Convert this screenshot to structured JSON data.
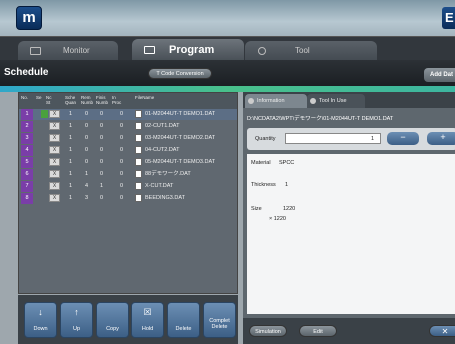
{
  "nav": {
    "monitor": "Monitor",
    "program": "Program",
    "tool": "Tool"
  },
  "header": {
    "title": "Schedule",
    "tcode": "T Code Conversion",
    "add": "Add Dat"
  },
  "columns": [
    "No.",
    "Se",
    "Nc\nSt",
    "Sche\nQuan",
    "Rem\nNumb",
    "Finis\nNumb",
    "In\nProc",
    "FileName"
  ],
  "rows": [
    {
      "no": "1",
      "q": "1",
      "r": "0",
      "f": "0",
      "file": "01-M2044UT-T DEMO1.DAT"
    },
    {
      "no": "2",
      "q": "1",
      "r": "0",
      "f": "0",
      "file": "02-CUT1.DAT"
    },
    {
      "no": "3",
      "q": "1",
      "r": "0",
      "f": "0",
      "file": "03-M2044UT-T DEMO2.DAT"
    },
    {
      "no": "4",
      "q": "1",
      "r": "0",
      "f": "0",
      "file": "04-CUT2.DAT"
    },
    {
      "no": "5",
      "q": "1",
      "r": "0",
      "f": "0",
      "file": "05-M2044UT-T DEMO3.DAT"
    },
    {
      "no": "6",
      "q": "1",
      "r": "1",
      "f": "0",
      "file": "88デモワーク.DAT"
    },
    {
      "no": "7",
      "q": "1",
      "r": "4",
      "f": "1",
      "file": "X-CUT.DAT"
    },
    {
      "no": "8",
      "q": "1",
      "r": "3",
      "f": "0",
      "file": "BEEDING3.DAT"
    }
  ],
  "buttons": {
    "down": "Down",
    "up": "Up",
    "copy": "Copy",
    "hold": "Hold",
    "delete": "Delete",
    "complete": "Complet\nDelete"
  },
  "panel": {
    "info_tab": "Information",
    "tool_tab": "Tool In Use",
    "path": "D:\\NCDATA2\\WPT\\デモワーク\\01-M2044UT-T DEMO1.DAT",
    "qty_label": "Quantity",
    "qty": "1",
    "material_label": "Material",
    "material": "SPCC",
    "thickness_label": "Thickness",
    "thickness": "1",
    "size_label": "Size",
    "size1": "1220",
    "size2": "× 1220",
    "simulation": "Simulation",
    "edit": "Edit"
  }
}
